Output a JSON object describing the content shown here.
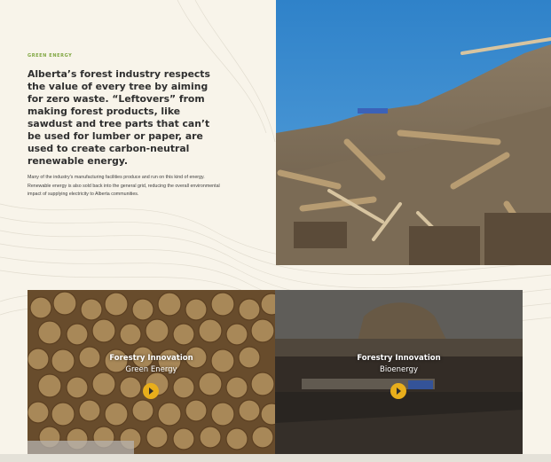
{
  "intro": {
    "eyebrow": "GREEN ENERGY",
    "headline": "Alberta’s forest industry respects the value of every tree by aiming for zero waste. “Leftovers” from making forest products, like sawdust and tree parts that can’t be used for lumber or paper, are used to create carbon-neutral renewable energy.",
    "body": "Many of the industry’s manufacturing facilities produce and run on this kind of energy. Renewable energy is also sold back into the general grid, reducing the overall environmental impact of supplying electricity to Alberta communities."
  },
  "cards": [
    {
      "title": "Forestry Innovation",
      "subtitle": "Green Energy",
      "button_icon": "play-arrow-icon"
    },
    {
      "title": "Forestry Innovation",
      "subtitle": "Bioenergy",
      "button_icon": "play-arrow-icon"
    }
  ],
  "colors": {
    "background": "#f8f4ea",
    "eyebrow": "#7fa640",
    "headline": "#2f2f2f",
    "button": "#e8ae1b"
  }
}
